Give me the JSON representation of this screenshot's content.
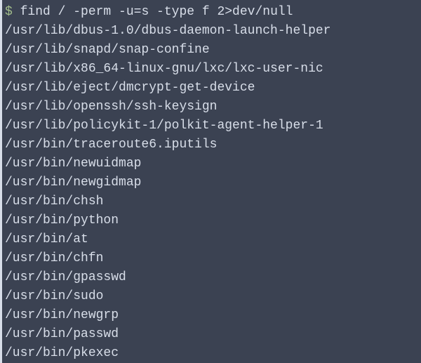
{
  "command_line": {
    "prompt": "$ ",
    "cmd": "find / -perm -u=s -type f 2>dev/null"
  },
  "output": [
    "/usr/lib/dbus-1.0/dbus-daemon-launch-helper",
    "/usr/lib/snapd/snap-confine",
    "/usr/lib/x86_64-linux-gnu/lxc/lxc-user-nic",
    "/usr/lib/eject/dmcrypt-get-device",
    "/usr/lib/openssh/ssh-keysign",
    "/usr/lib/policykit-1/polkit-agent-helper-1",
    "/usr/bin/traceroute6.iputils",
    "/usr/bin/newuidmap",
    "/usr/bin/newgidmap",
    "/usr/bin/chsh",
    "/usr/bin/python",
    "/usr/bin/at",
    "/usr/bin/chfn",
    "/usr/bin/gpasswd",
    "/usr/bin/sudo",
    "/usr/bin/newgrp",
    "/usr/bin/passwd",
    "/usr/bin/pkexec"
  ]
}
